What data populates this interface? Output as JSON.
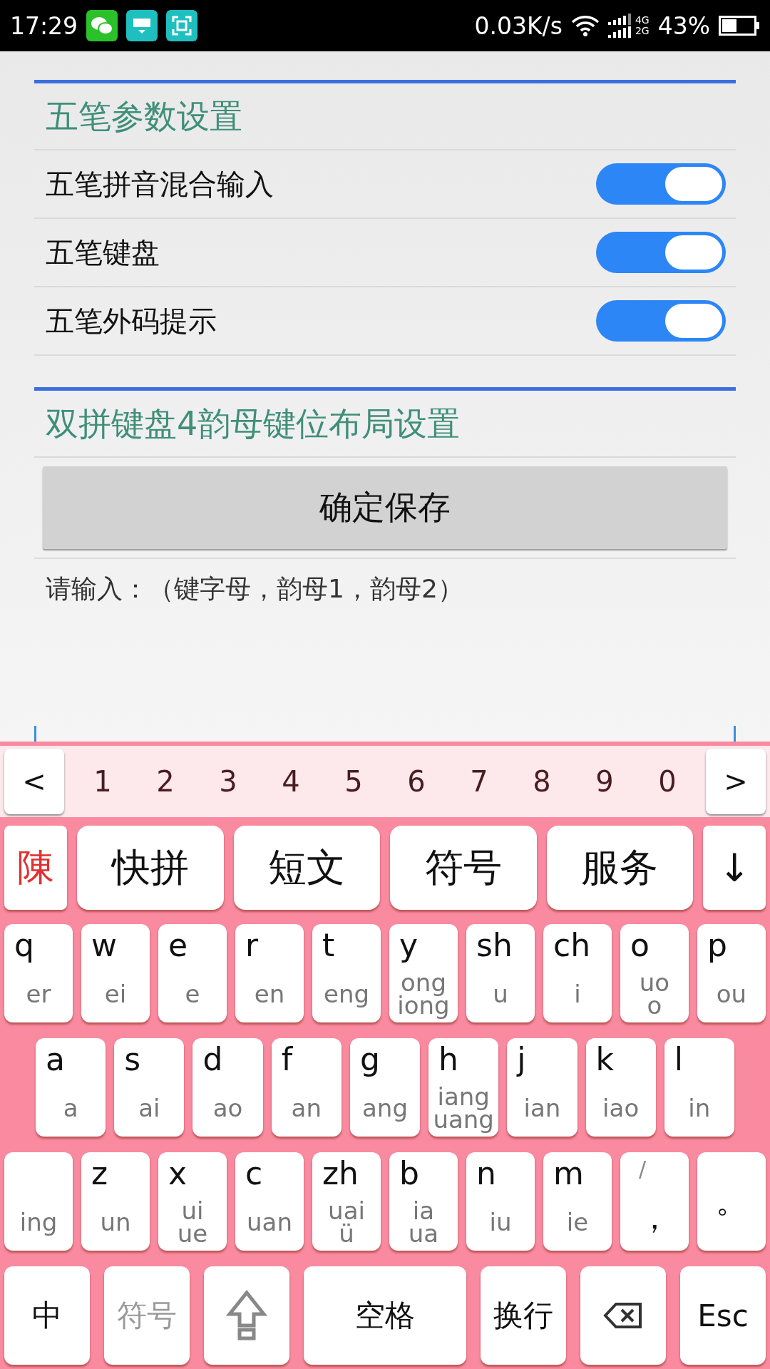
{
  "status_bar": {
    "time": "17:29",
    "net_speed": "0.03K/s",
    "network_types": [
      "4G",
      "2G"
    ],
    "battery": "43%"
  },
  "sections": [
    {
      "title": "五笔参数设置",
      "rows": [
        {
          "label": "五笔拼音混合输入",
          "on": true
        },
        {
          "label": "五笔键盘",
          "on": true
        },
        {
          "label": "五笔外码提示",
          "on": true
        }
      ]
    },
    {
      "title": "双拼键盘4韵母键位布局设置",
      "button": "确定保存",
      "hint": "请输入：（键字母，韵母1，韵母2）"
    }
  ],
  "keyboard": {
    "candidate_bar": {
      "prev": "<",
      "next": ">",
      "digits": [
        "1",
        "2",
        "3",
        "4",
        "5",
        "6",
        "7",
        "8",
        "9",
        "0"
      ]
    },
    "function_row": {
      "logo": "陳",
      "keys": [
        "快拼",
        "短文",
        "符号",
        "服务"
      ],
      "collapse": "↓"
    },
    "rows": [
      [
        {
          "kind": "letter",
          "main": "q",
          "sub": [
            "er"
          ]
        },
        {
          "kind": "letter",
          "main": "w",
          "sub": [
            "ei"
          ]
        },
        {
          "kind": "letter",
          "main": "e",
          "sub": [
            "e"
          ]
        },
        {
          "kind": "letter",
          "main": "r",
          "sub": [
            "en"
          ]
        },
        {
          "kind": "letter",
          "main": "t",
          "sub": [
            "eng"
          ]
        },
        {
          "kind": "letter",
          "main": "y",
          "sub": [
            "ong",
            "iong"
          ]
        },
        {
          "kind": "letter",
          "main": "sh",
          "sub": [
            "u"
          ]
        },
        {
          "kind": "letter",
          "main": "ch",
          "sub": [
            "i"
          ]
        },
        {
          "kind": "letter",
          "main": "o",
          "sub": [
            "uo",
            "o"
          ]
        },
        {
          "kind": "letter",
          "main": "p",
          "sub": [
            "ou"
          ]
        }
      ],
      [
        {
          "kind": "letter",
          "main": "a",
          "sub": [
            "a"
          ]
        },
        {
          "kind": "letter",
          "main": "s",
          "sub": [
            "ai"
          ]
        },
        {
          "kind": "letter",
          "main": "d",
          "sub": [
            "ao"
          ]
        },
        {
          "kind": "letter",
          "main": "f",
          "sub": [
            "an"
          ]
        },
        {
          "kind": "letter",
          "main": "g",
          "sub": [
            "ang"
          ]
        },
        {
          "kind": "letter",
          "main": "h",
          "sub": [
            "iang",
            "uang"
          ]
        },
        {
          "kind": "letter",
          "main": "j",
          "sub": [
            "ian"
          ]
        },
        {
          "kind": "letter",
          "main": "k",
          "sub": [
            "iao"
          ]
        },
        {
          "kind": "letter",
          "main": "l",
          "sub": [
            "in"
          ]
        }
      ],
      [
        {
          "kind": "letter",
          "sub": [
            "ing"
          ]
        },
        {
          "kind": "letter",
          "main": "z",
          "sub": [
            "un"
          ]
        },
        {
          "kind": "letter",
          "main": "x",
          "sub": [
            "ui",
            "ue"
          ]
        },
        {
          "kind": "letter",
          "main": "c",
          "sub": [
            "uan"
          ]
        },
        {
          "kind": "letter",
          "main": "zh",
          "sub": [
            "uai",
            "ü"
          ]
        },
        {
          "kind": "letter",
          "main": "b",
          "sub": [
            "ia",
            "ua"
          ]
        },
        {
          "kind": "letter",
          "main": "n",
          "sub": [
            "iu"
          ]
        },
        {
          "kind": "letter",
          "main": "m",
          "sub": [
            "ie"
          ]
        },
        {
          "kind": "punct",
          "top": "/",
          "main": "，"
        },
        {
          "kind": "punct",
          "main": "。"
        }
      ]
    ],
    "bottom_row": [
      {
        "kind": "text",
        "label": "中",
        "disabled": false
      },
      {
        "kind": "text",
        "label": "符号",
        "disabled": true
      },
      {
        "kind": "shift",
        "disabled": false
      },
      {
        "kind": "space",
        "label": "空格",
        "disabled": false
      },
      {
        "kind": "text",
        "label": "换行",
        "disabled": false
      },
      {
        "kind": "backspace",
        "disabled": false
      },
      {
        "kind": "text",
        "label": "Esc",
        "disabled": false
      }
    ]
  }
}
